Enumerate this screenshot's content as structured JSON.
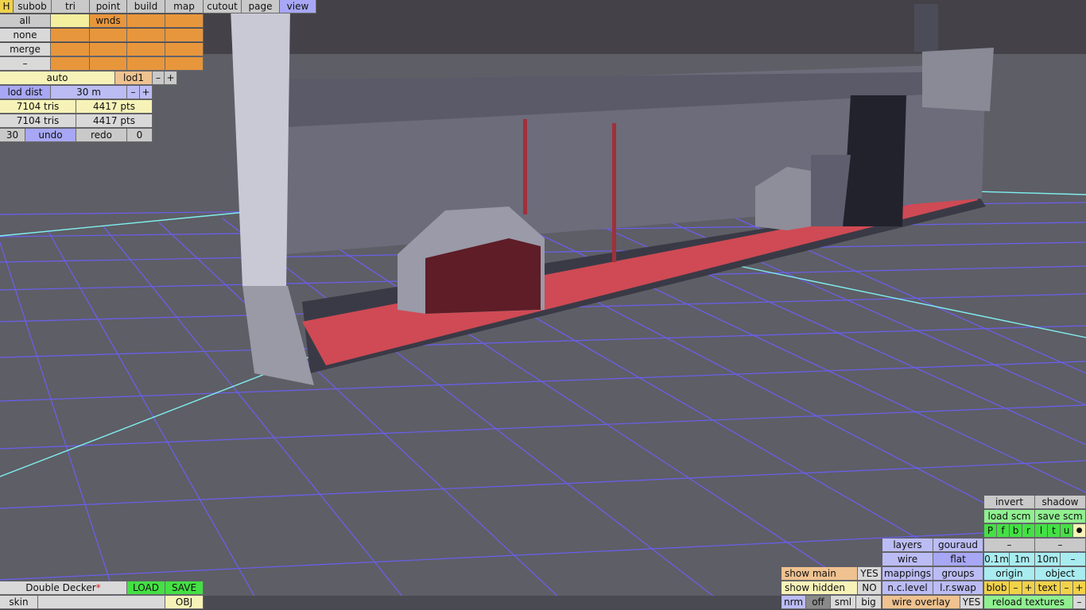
{
  "tabs": [
    "H",
    "subob",
    "tri",
    "point",
    "build",
    "map",
    "cutout",
    "page",
    "view"
  ],
  "select": {
    "all": "all",
    "wnds": "wnds",
    "none": "none",
    "merge": "merge",
    "minus": "–"
  },
  "lod": {
    "auto": "auto",
    "level": "lod1",
    "minus": "–",
    "plus": "+",
    "dist_label": "lod dist",
    "dist_value": "30 m",
    "dist_minus": "–",
    "dist_plus": "+"
  },
  "stats": {
    "row1_tris": "7104 tris",
    "row1_pts": "4417 pts",
    "row2_tris": "7104 tris",
    "row2_pts": "4417 pts"
  },
  "history": {
    "count": "30",
    "undo": "undo",
    "redo": "redo",
    "redo_count": "0"
  },
  "file": {
    "name": "Double Decker",
    "modified_mark": "*",
    "load": "LOAD",
    "save": "SAVE",
    "skin": "skin",
    "obj": "OBJ"
  },
  "display": {
    "show_main": "show main",
    "show_main_val": "YES",
    "show_hidden": "show hidden",
    "show_hidden_val": "NO",
    "nrm": "nrm",
    "off": "off",
    "sml": "sml",
    "big": "big"
  },
  "render": {
    "layers": "layers",
    "gouraud": "gouraud",
    "wire": "wire",
    "flat": "flat",
    "mappings": "mappings",
    "groups": "groups",
    "nc_level": "n.c.level",
    "lr_swap": "l.r.swap",
    "wire_overlay": "wire overlay",
    "wire_overlay_val": "YES"
  },
  "right": {
    "invert": "invert",
    "shadow": "shadow",
    "load_scm": "load scm",
    "save_scm": "save scm",
    "flags": [
      "P",
      "f",
      "b",
      "r",
      "l",
      "t",
      "u"
    ],
    "dot": "●",
    "minus_a": "–",
    "minus_b": "–",
    "grid1": "0.1m",
    "grid2": "1m",
    "grid3": "10m",
    "grid_minus": "–",
    "origin": "origin",
    "object": "object",
    "blob": "blob",
    "blob_minus": "–",
    "blob_plus": "+",
    "text": "text",
    "text_minus": "–",
    "text_plus": "+",
    "reload": "reload textures",
    "reload_minus": "–"
  },
  "colors": {
    "bus_red": "#cf4a54",
    "bus_gray": "#6c6c7a",
    "grid_blue": "#6a5ff0",
    "grid_cyan": "#7ff0f0"
  }
}
